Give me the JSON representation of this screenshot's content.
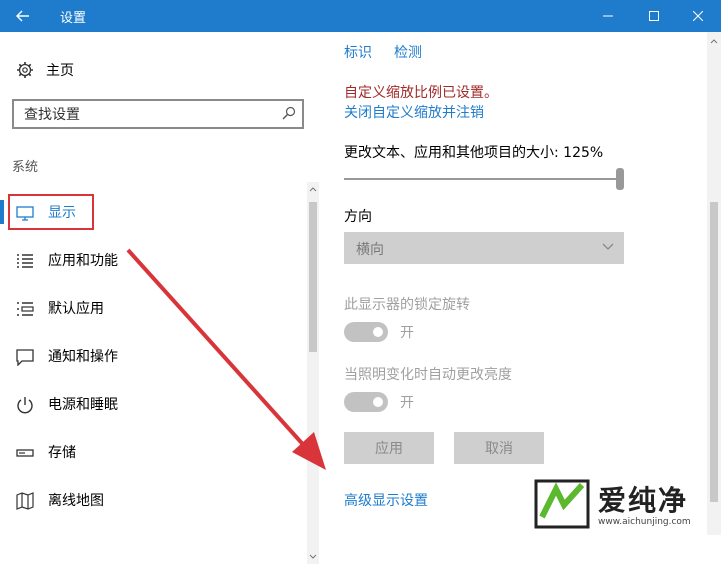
{
  "window": {
    "title": "设置",
    "minimize_label": "—",
    "maximize_label": "☐",
    "close_label": "✕"
  },
  "sidebar": {
    "home_label": "主页",
    "search_placeholder": "查找设置",
    "section_label": "系统",
    "items": [
      {
        "label": "显示",
        "icon": "monitor-icon",
        "active": true
      },
      {
        "label": "应用和功能",
        "icon": "list-icon"
      },
      {
        "label": "默认应用",
        "icon": "default-apps-icon"
      },
      {
        "label": "通知和操作",
        "icon": "message-icon"
      },
      {
        "label": "电源和睡眠",
        "icon": "power-icon"
      },
      {
        "label": "存储",
        "icon": "drive-icon"
      },
      {
        "label": "离线地图",
        "icon": "map-icon"
      }
    ]
  },
  "main": {
    "top_links": {
      "identify": "标识",
      "detect": "检测"
    },
    "custom_scale_notice": "自定义缩放比例已设置。",
    "turn_off_link": "关闭自定义缩放并注销",
    "scale_label": "更改文本、应用和其他项目的大小: 125%",
    "scale_percent": 125,
    "orientation_label": "方向",
    "orientation_value": "横向",
    "rotation_lock_label": "此显示器的锁定旋转",
    "rotation_lock_state": "开",
    "auto_brightness_label": "当照明变化时自动更改亮度",
    "auto_brightness_state": "开",
    "apply_button": "应用",
    "cancel_button": "取消",
    "advanced_link": "高级显示设置"
  },
  "watermark": {
    "brand": "爱纯净",
    "url": "www.aichunjing.com"
  },
  "colors": {
    "accent": "#1f7ccd",
    "highlight_red": "#d9343a",
    "notice_red": "#a12a2a"
  }
}
